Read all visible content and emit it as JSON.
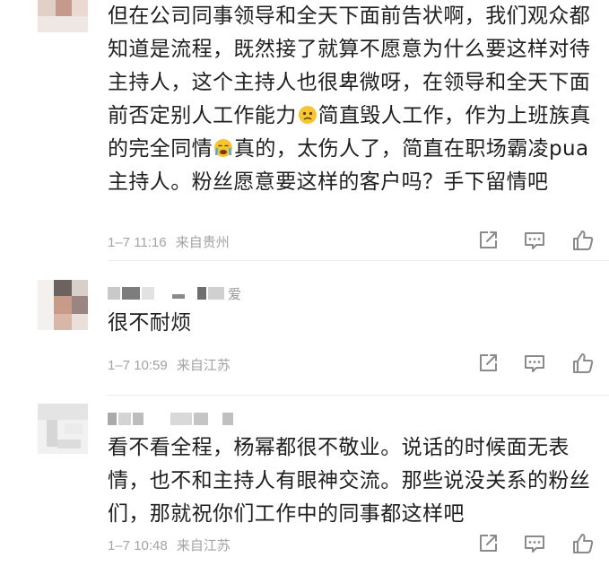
{
  "comments": [
    {
      "text_a": "但在公司同事领导和全天下面前告状啊，我们观众都知道是流程，既然接了就算不愿意为什么要这样对待主持人，这个主持人也很卑微呀，在领导和全天下面前否定别人工作能力",
      "emoji_1": "worried-face",
      "text_b": "简直毁人工作，作为上班族真的完全同情",
      "emoji_2": "crying-face",
      "text_c": "真的，太伤人了，简直在职场霸凌pua主持人。粉丝愿意要这样的客户吗？手下留情吧",
      "time": "1–7 11:16",
      "location": "来自贵州"
    },
    {
      "username_partial": "爱",
      "text": "很不耐烦",
      "time": "1–7 10:59",
      "location": "来自江苏"
    },
    {
      "text": "看不看全程，杨幂都很不敬业。说话的时候面无表情，也不和主持人有眼神交流。那些说没关系的粉丝们，那就祝你们工作中的同事都这样吧",
      "time": "1–7 10:48",
      "location": "来自江苏"
    }
  ],
  "actions": {
    "share": "share-icon",
    "reply": "comment-icon",
    "like": "thumbs-up-icon"
  },
  "colors": {
    "text": "#1f1f1f",
    "meta": "#a3a3a3",
    "icon": "#8a8a8a",
    "emoji": "#f7c531"
  }
}
